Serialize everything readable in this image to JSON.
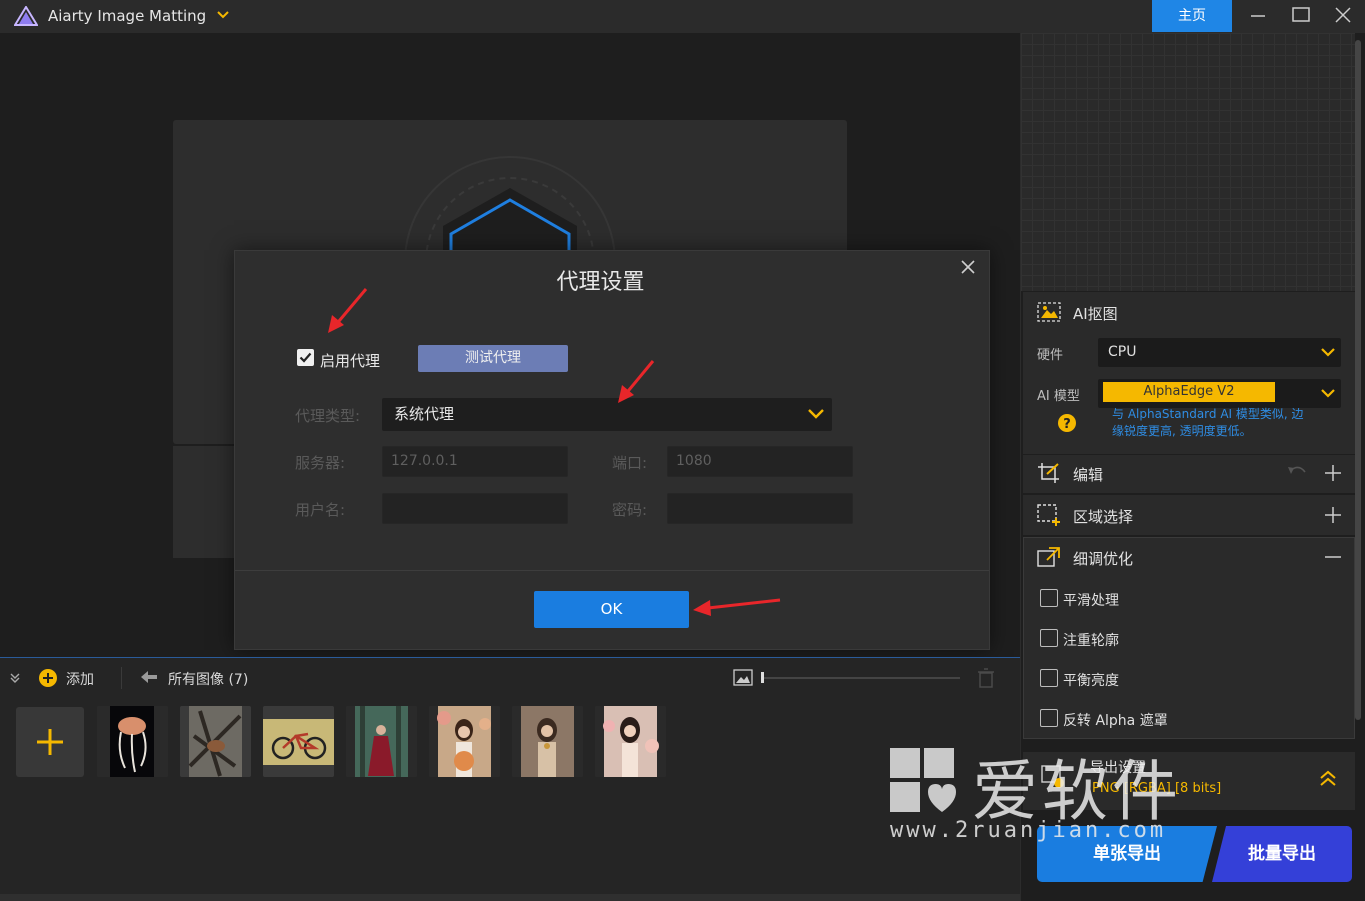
{
  "titlebar": {
    "app_title": "Aiarty Image Matting",
    "home_label": "主页"
  },
  "dialog": {
    "title": "代理设置",
    "enable_proxy_label": "启用代理",
    "enable_proxy_checked": true,
    "test_proxy_label": "测试代理",
    "proxy_type_label": "代理类型:",
    "proxy_type_value": "系统代理",
    "server_label": "服务器:",
    "server_value": "127.0.0.1",
    "port_label": "端口:",
    "port_value": "1080",
    "username_label": "用户名:",
    "username_value": "",
    "password_label": "密码:",
    "password_value": "",
    "ok_label": "OK"
  },
  "bottom": {
    "add_label": "添加",
    "all_images_label": "所有图像 (7)",
    "thumbnails": [
      "jellyfish",
      "bird-on-branch",
      "bicycle",
      "woman-in-forest",
      "woman-with-flowers-1",
      "woman-with-flowers-2",
      "woman-with-flowers-3"
    ]
  },
  "right_panel": {
    "ai_matting_title": "AI抠图",
    "hardware_label": "硬件",
    "hardware_value": "CPU",
    "ai_model_label": "AI 模型",
    "ai_model_value": "AlphaEdge  V2",
    "model_hint": "与 AlphaStandard AI 模型类似, 边缘锐度更高, 透明度更低。",
    "edit_title": "编辑",
    "region_title": "区域选择",
    "refine_title": "细调优化",
    "options": [
      {
        "label": "平滑处理",
        "checked": false
      },
      {
        "label": "注重轮廓",
        "checked": false
      },
      {
        "label": "平衡亮度",
        "checked": false
      },
      {
        "label": "反转 Alpha 遮罩",
        "checked": false
      }
    ],
    "export_settings_title": "导出设置",
    "export_format": "PNG [RGBA] [8 bits]",
    "export_single_label": "单张导出",
    "export_batch_label": "批量导出"
  },
  "watermark": {
    "text": "爱软件",
    "url": "www.2ruanjian.com"
  },
  "colors": {
    "accent_blue": "#1a7de0",
    "accent_yellow": "#f5b800",
    "arrow_red": "#e8262a"
  }
}
